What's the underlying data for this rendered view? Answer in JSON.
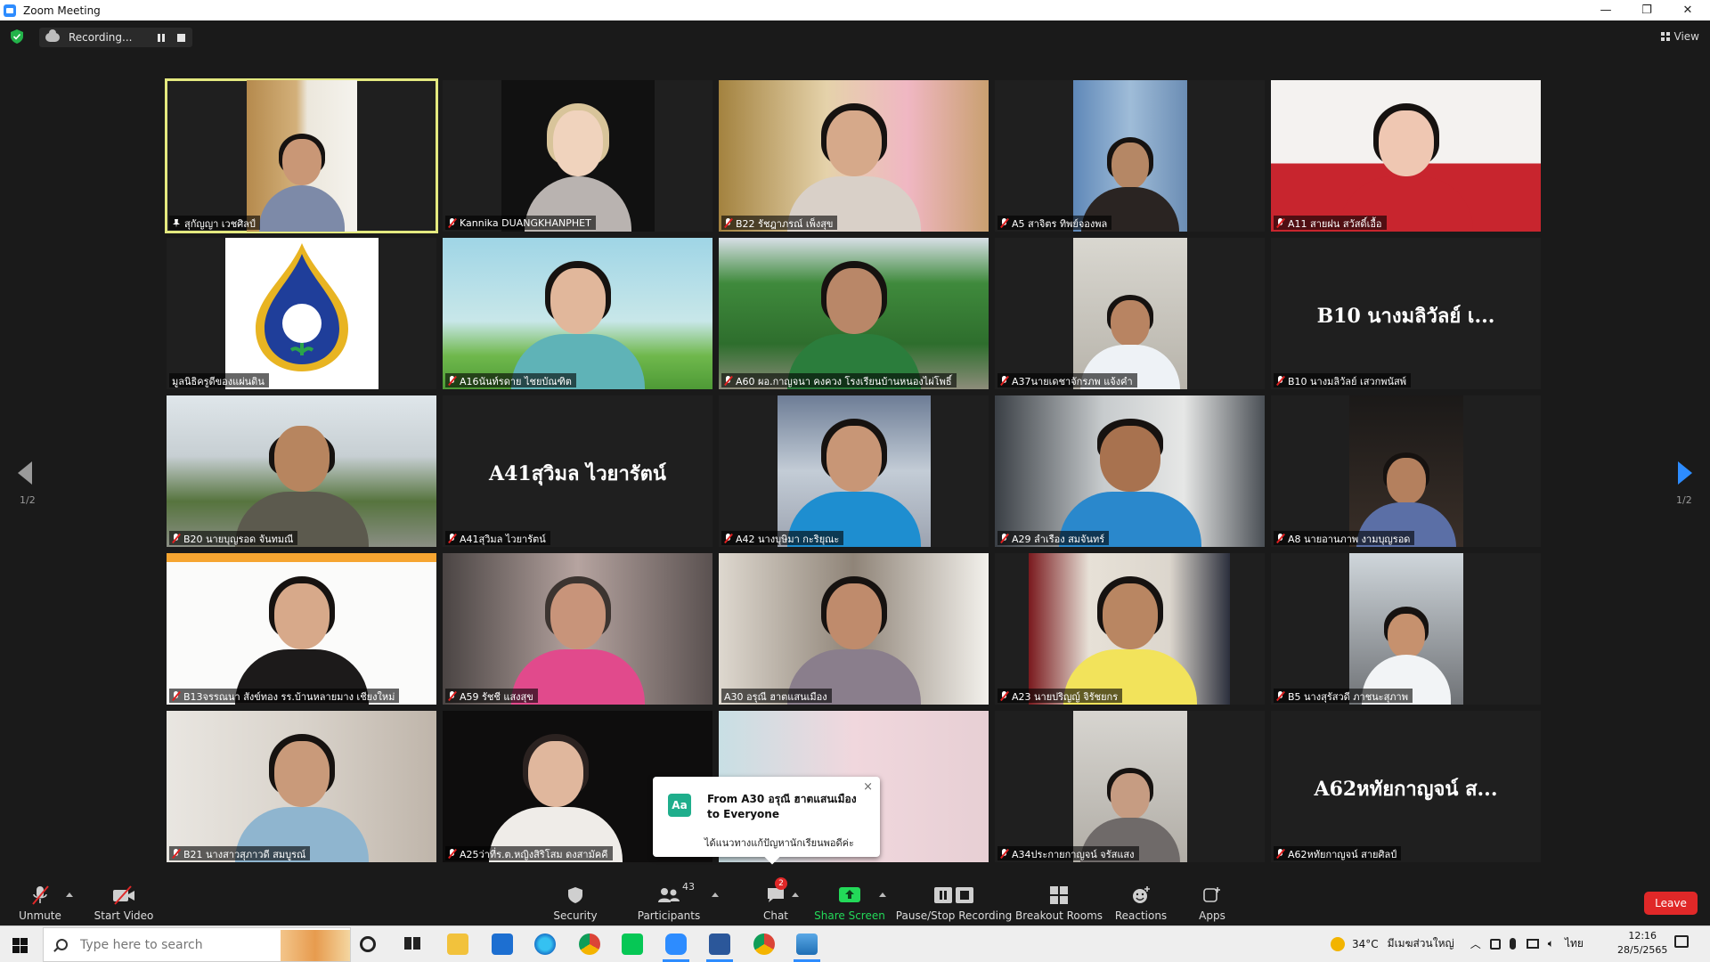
{
  "window": {
    "title": "Zoom Meeting",
    "minimize": "—",
    "restore": "❐",
    "close": "✕"
  },
  "status_bar": {
    "recording_label": "Recording...",
    "view_label": "View"
  },
  "gallery": {
    "page_left": "1/2",
    "page_right": "1/2",
    "tiles": [
      {
        "name": "สุกัญญา เวชศิลป์",
        "active": true,
        "pinned": true
      },
      {
        "name": "Kannika DUANGKHANPHET"
      },
      {
        "name": "B22 รัชฎาภรณ์ เพ็งสุข"
      },
      {
        "name": "A5 สาจิตร ทิพย์จองพล"
      },
      {
        "name": "A11 สายฝน สวัสดิ์เอื้อ"
      },
      {
        "name": "มูลนิธิครูดีของแผ่นดิน",
        "no_mic_icon": true
      },
      {
        "name": "A16นันท์รดาย ไชยบัณฑิต"
      },
      {
        "name": "A60 ผอ.กาญจนา คงควง โรงเรียนบ้านหนองไผ่โพธิ์"
      },
      {
        "name": "A37นายเดชาจักรภพ แจ้งคำ"
      },
      {
        "name": "B10 นางมลิวัลย์ เสวกพนัสพ์",
        "display_name": "B10 นางมลิวัลย์ เ..."
      },
      {
        "name": "B20 นายบุญรอด จันทมณี"
      },
      {
        "name": "A41สุวิมล ไวยารัตน์",
        "display_name": "A41สุวิมล ไวยารัตน์"
      },
      {
        "name": "A42 นางบุษิมา กะริยุณะ"
      },
      {
        "name": "A29 ลำเรือง สมจันทร์"
      },
      {
        "name": "A8 นายอานภาพ งามบุญรอด"
      },
      {
        "name": "B13จรรณนา สังข์ทอง รร.บ้านหลายมาง เชียงใหม่"
      },
      {
        "name": "A59 รัชชี แสงสุข"
      },
      {
        "name": "A30 อรุณี ฮาตแสนเมือง",
        "no_mic_icon": true
      },
      {
        "name": "A23 นายปริญญ์ จิรัชยกร"
      },
      {
        "name": "B5 นางสุรัสวดี ภาชนะสุภาพ"
      },
      {
        "name": "B21 นางสาวสุภาวดี สมบูรณ์"
      },
      {
        "name": "A25ว่าที่ร.ต.หญิงสิริโสม ดงสามัคคี"
      },
      {
        "name": ""
      },
      {
        "name": "A34ประกายกาญจน์ จรัสแสง"
      },
      {
        "name": "A62หทัยกาญจน์ สายศิลป์",
        "display_name": "A62หทัยกาญจน์ ส..."
      }
    ]
  },
  "chat_popup": {
    "avatar": "Aa",
    "from": "From A30 อรุณี ฮาตแสนเมือง to Everyone",
    "message": "ได้แนวทางแก้ปัญหานักเรียนพอดีค่ะ",
    "close": "×"
  },
  "toolbar": {
    "unmute": "Unmute",
    "start_video": "Start Video",
    "security": "Security",
    "participants": "Participants",
    "participants_count": "43",
    "chat": "Chat",
    "chat_badge": "2",
    "share_screen": "Share Screen",
    "pause_stop_recording": "Pause/Stop Recording",
    "breakout_rooms": "Breakout Rooms",
    "reactions": "Reactions",
    "apps": "Apps",
    "leave": "Leave",
    "share_color": "#23d959",
    "leave_color": "#e02828"
  },
  "taskbar": {
    "search_placeholder": "Type here to search",
    "weather": "34°C",
    "weather_text": "มีเมฆส่วนใหญ่",
    "language": "ไทย",
    "time": "12:16",
    "date": "28/5/2565"
  }
}
